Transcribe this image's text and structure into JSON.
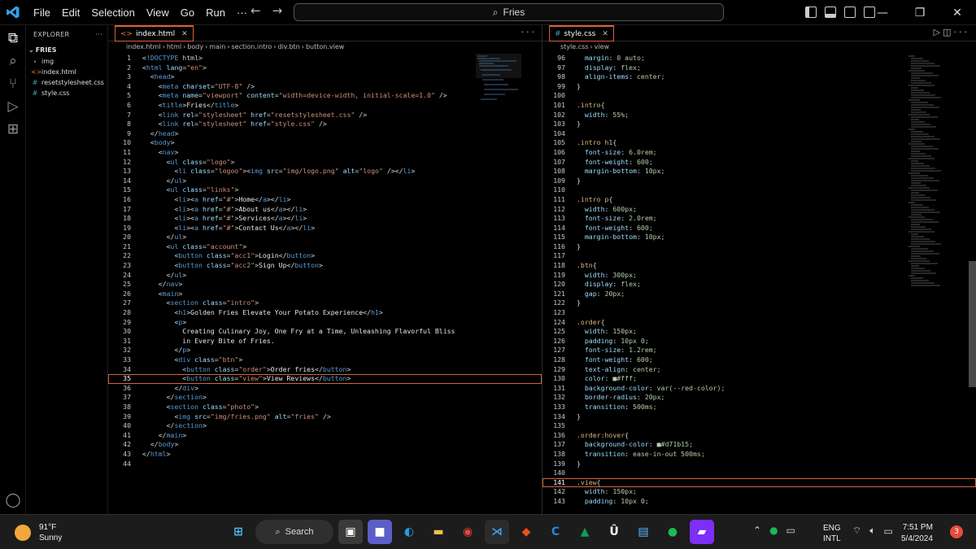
{
  "title_bar": {
    "menu": [
      "File",
      "Edit",
      "Selection",
      "View",
      "Go",
      "Run",
      "···"
    ],
    "search": "Fries"
  },
  "explorer": {
    "header": "EXPLORER",
    "more": "···",
    "root": "FRIES",
    "items": [
      {
        "label": "img",
        "icon": "›"
      },
      {
        "label": "index.html",
        "icon": "<>"
      },
      {
        "label": "resetstylesheet.css",
        "icon": "#"
      },
      {
        "label": "style.css",
        "icon": "#"
      }
    ]
  },
  "left_editor": {
    "tab": "index.html",
    "breadcrumb": [
      "index.html",
      "html",
      "body",
      "main",
      "section.intro",
      "div.btn",
      "button.view"
    ],
    "current_line": 35,
    "lines": [
      {
        "n": 1,
        "code": "<!DOCTYPE html>"
      },
      {
        "n": 2,
        "code": "<html lang=\"en\">"
      },
      {
        "n": 3,
        "code": "  <head>"
      },
      {
        "n": 4,
        "code": "    <meta charset=\"UTF-8\" />"
      },
      {
        "n": 5,
        "code": "    <meta name=\"viewport\" content=\"width=device-width, initial-scale=1.0\" />"
      },
      {
        "n": 6,
        "code": "    <title>Fries</title>"
      },
      {
        "n": 7,
        "code": "    <link rel=\"stylesheet\" href=\"resetstylesheet.css\" />"
      },
      {
        "n": 8,
        "code": "    <link rel=\"stylesheet\" href=\"style.css\" />"
      },
      {
        "n": 9,
        "code": "  </head>"
      },
      {
        "n": 10,
        "code": "  <body>"
      },
      {
        "n": 11,
        "code": "    <nav>"
      },
      {
        "n": 12,
        "code": "      <ul class=\"logo\">"
      },
      {
        "n": 13,
        "code": "        <li class=\"logoo\"><img src=\"img/logo.png\" alt=\"logo\" /></li>"
      },
      {
        "n": 14,
        "code": "      </ul>"
      },
      {
        "n": 15,
        "code": "      <ul class=\"links\">"
      },
      {
        "n": 16,
        "code": "        <li><a href=\"#\">Home</a></li>"
      },
      {
        "n": 17,
        "code": "        <li><a href=\"#\">About us</a></li>"
      },
      {
        "n": 18,
        "code": "        <li><a href=\"#\">Services</a></li>"
      },
      {
        "n": 19,
        "code": "        <li><a href=\"#\">Contact Us</a></li>"
      },
      {
        "n": 20,
        "code": "      </ul>"
      },
      {
        "n": 21,
        "code": "      <ul class=\"account\">"
      },
      {
        "n": 22,
        "code": "        <button class=\"acc1\">Login</button>"
      },
      {
        "n": 23,
        "code": "        <button class=\"acc2\">Sign Up</button>"
      },
      {
        "n": 24,
        "code": "      </ul>"
      },
      {
        "n": 25,
        "code": "    </nav>"
      },
      {
        "n": 26,
        "code": "    <main>"
      },
      {
        "n": 27,
        "code": "      <section class=\"intro\">"
      },
      {
        "n": 28,
        "code": "        <h1>Golden Fries Elevate Your Potato Experience</h1>"
      },
      {
        "n": 29,
        "code": "        <p>"
      },
      {
        "n": 30,
        "code": "          Creating Culinary Joy, One Fry at a Time, Unleashing Flavorful Bliss"
      },
      {
        "n": 31,
        "code": "          in Every Bite of Fries."
      },
      {
        "n": 32,
        "code": "        </p>"
      },
      {
        "n": 33,
        "code": "        <div class=\"btn\">"
      },
      {
        "n": 34,
        "code": "          <button class=\"order\">Order fries</button>"
      },
      {
        "n": 35,
        "code": "          <button class=\"view\">View Reviews</button>"
      },
      {
        "n": 36,
        "code": "        </div>"
      },
      {
        "n": 37,
        "code": "      </section>"
      },
      {
        "n": 38,
        "code": "      <section class=\"photo\">"
      },
      {
        "n": 39,
        "code": "        <img src=\"img/fries.png\" alt=\"fries\" />"
      },
      {
        "n": 40,
        "code": "      </section>"
      },
      {
        "n": 41,
        "code": "    </main>"
      },
      {
        "n": 42,
        "code": "  </body>"
      },
      {
        "n": 43,
        "code": "</html>"
      },
      {
        "n": 44,
        "code": ""
      }
    ]
  },
  "right_editor": {
    "tab": "style.css",
    "breadcrumb": [
      "style.css",
      "view"
    ],
    "current_line": 141,
    "lines": [
      {
        "n": 96,
        "code": "  margin: 0 auto;"
      },
      {
        "n": 97,
        "code": "  display: flex;"
      },
      {
        "n": 98,
        "code": "  align-items: center;"
      },
      {
        "n": 99,
        "code": "}"
      },
      {
        "n": 100,
        "code": ""
      },
      {
        "n": 101,
        "code": ".intro{"
      },
      {
        "n": 102,
        "code": "  width: 55%;"
      },
      {
        "n": 103,
        "code": "}"
      },
      {
        "n": 104,
        "code": ""
      },
      {
        "n": 105,
        "code": ".intro h1{"
      },
      {
        "n": 106,
        "code": "  font-size: 6.0rem;"
      },
      {
        "n": 107,
        "code": "  font-weight: 600;"
      },
      {
        "n": 108,
        "code": "  margin-bottom: 10px;"
      },
      {
        "n": 109,
        "code": "}"
      },
      {
        "n": 110,
        "code": ""
      },
      {
        "n": 111,
        "code": ".intro p{"
      },
      {
        "n": 112,
        "code": "  width: 600px;"
      },
      {
        "n": 113,
        "code": "  font-size: 2.0rem;"
      },
      {
        "n": 114,
        "code": "  font-weight: 600;"
      },
      {
        "n": 115,
        "code": "  margin-bottom: 10px;"
      },
      {
        "n": 116,
        "code": "}"
      },
      {
        "n": 117,
        "code": ""
      },
      {
        "n": 118,
        "code": ".btn{"
      },
      {
        "n": 119,
        "code": "  width: 300px;"
      },
      {
        "n": 120,
        "code": "  display: flex;"
      },
      {
        "n": 121,
        "code": "  gap: 20px;"
      },
      {
        "n": 122,
        "code": "}"
      },
      {
        "n": 123,
        "code": ""
      },
      {
        "n": 124,
        "code": ".order{"
      },
      {
        "n": 125,
        "code": "  width: 150px;"
      },
      {
        "n": 126,
        "code": "  padding: 10px 0;"
      },
      {
        "n": 127,
        "code": "  font-size: 1.2rem;"
      },
      {
        "n": 128,
        "code": "  font-weight: 600;"
      },
      {
        "n": 129,
        "code": "  text-align: center;"
      },
      {
        "n": 130,
        "code": "  color: ■#fff;"
      },
      {
        "n": 131,
        "code": "  background-color: var(--red-color);"
      },
      {
        "n": 132,
        "code": "  border-radius: 20px;"
      },
      {
        "n": 133,
        "code": "  transition: 500ms;"
      },
      {
        "n": 134,
        "code": "}"
      },
      {
        "n": 135,
        "code": ""
      },
      {
        "n": 136,
        "code": ".order:hover{"
      },
      {
        "n": 137,
        "code": "  background-color: ■#d71b15;"
      },
      {
        "n": 138,
        "code": "  transition: ease-in-out 500ms;"
      },
      {
        "n": 139,
        "code": "}"
      },
      {
        "n": 140,
        "code": ""
      },
      {
        "n": 141,
        "code": ".view{"
      },
      {
        "n": 142,
        "code": "  width: 150px;"
      },
      {
        "n": 143,
        "code": "  padding: 10px 0;"
      }
    ]
  },
  "statusbar": {
    "temp": "91°F",
    "condition": "Sunny",
    "search": "Search",
    "lang1": "ENG",
    "lang2": "INTL",
    "time": "7:51 PM",
    "date": "5/4/2024",
    "notifications": "3"
  },
  "colors": {
    "accent": "#e05d35",
    "keyword": "#569cd6",
    "string": "#ce9178",
    "attr": "#9cdcfe",
    "selector": "#d7ba7d"
  }
}
